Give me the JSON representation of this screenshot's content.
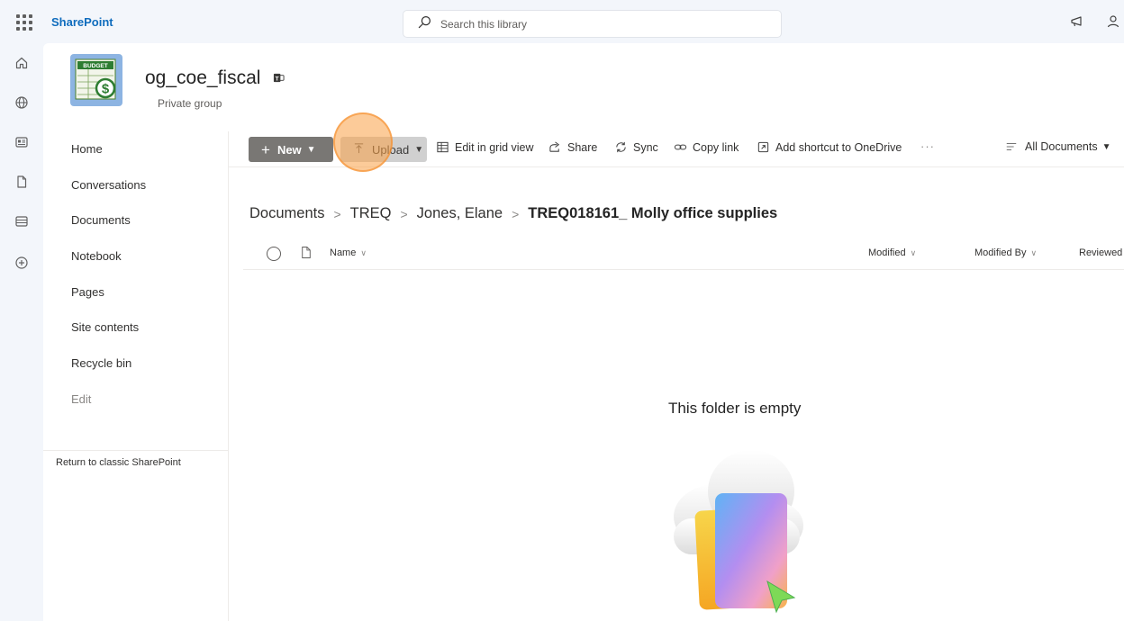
{
  "suite": {
    "brand": "SharePoint",
    "search_placeholder": "Search this library",
    "icons": [
      "app-launcher-icon",
      "search-icon",
      "megaphone-icon",
      "person-icon"
    ]
  },
  "appbar": {
    "items": [
      "home-icon",
      "globe-icon",
      "news-icon",
      "file-icon",
      "list-icon",
      "add-icon"
    ]
  },
  "site": {
    "logo_text": "BUDGET",
    "title": "og_coe_fiscal",
    "subtitle": "Private group"
  },
  "nav": {
    "items": [
      {
        "label": "Home"
      },
      {
        "label": "Conversations"
      },
      {
        "label": "Documents"
      },
      {
        "label": "Notebook"
      },
      {
        "label": "Pages"
      },
      {
        "label": "Site contents"
      },
      {
        "label": "Recycle bin"
      },
      {
        "label": "Edit"
      }
    ],
    "classic_link": "Return to classic SharePoint"
  },
  "commands": {
    "new": "New",
    "upload": "Upload",
    "edit_grid": "Edit in grid view",
    "share": "Share",
    "sync": "Sync",
    "copy_link": "Copy link",
    "add_shortcut": "Add shortcut to OneDrive",
    "overflow": "···",
    "view": "All Documents"
  },
  "breadcrumb": [
    "Documents",
    "TREQ",
    "Jones, Elane",
    "TREQ018161_ Molly office supplies"
  ],
  "columns": {
    "name": "Name",
    "modified": "Modified",
    "modified_by": "Modified By",
    "reviewed": "Reviewed"
  },
  "empty_state": {
    "title": "This folder is empty"
  },
  "colors": {
    "brand": "#0f6cbd",
    "new_button": "#797774",
    "upload_hover": "#d0d0d0",
    "click_highlight": "#f6a04d"
  }
}
